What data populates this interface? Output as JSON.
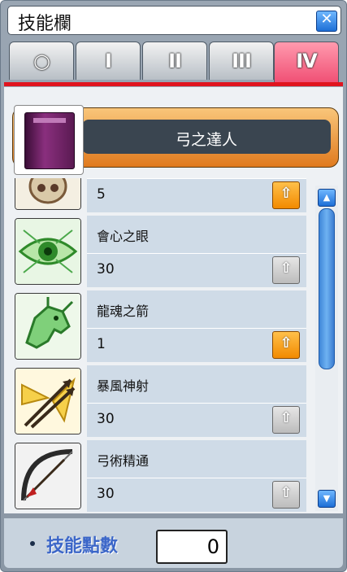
{
  "window": {
    "title": "技能欄"
  },
  "tabs": [
    {
      "label": "○"
    },
    {
      "label": "I"
    },
    {
      "label": "II"
    },
    {
      "label": "III"
    },
    {
      "label": "IV"
    }
  ],
  "job": {
    "name": "弓之達人"
  },
  "skills": [
    {
      "name": "",
      "level": "5",
      "upgradable": true,
      "icon": "skull-mask-icon"
    },
    {
      "name": "會心之眼",
      "level": "30",
      "upgradable": false,
      "icon": "eye-icon"
    },
    {
      "name": "龍魂之箭",
      "level": "1",
      "upgradable": true,
      "icon": "dragon-icon"
    },
    {
      "name": "暴風神射",
      "level": "30",
      "upgradable": false,
      "icon": "crossed-arrows-icon"
    },
    {
      "name": "弓術精通",
      "level": "30",
      "upgradable": false,
      "icon": "bow-icon"
    }
  ],
  "buttons": {
    "up_symbol": "⇧",
    "close_symbol": "✕",
    "scroll_up": "▲",
    "scroll_down": "▼"
  },
  "skill_points": {
    "label": "技能點數",
    "value": "0"
  },
  "colors": {
    "active_tab": "#f04f74",
    "upgrade_on": "#f28a00",
    "accent_blue": "#1e6fd6"
  }
}
